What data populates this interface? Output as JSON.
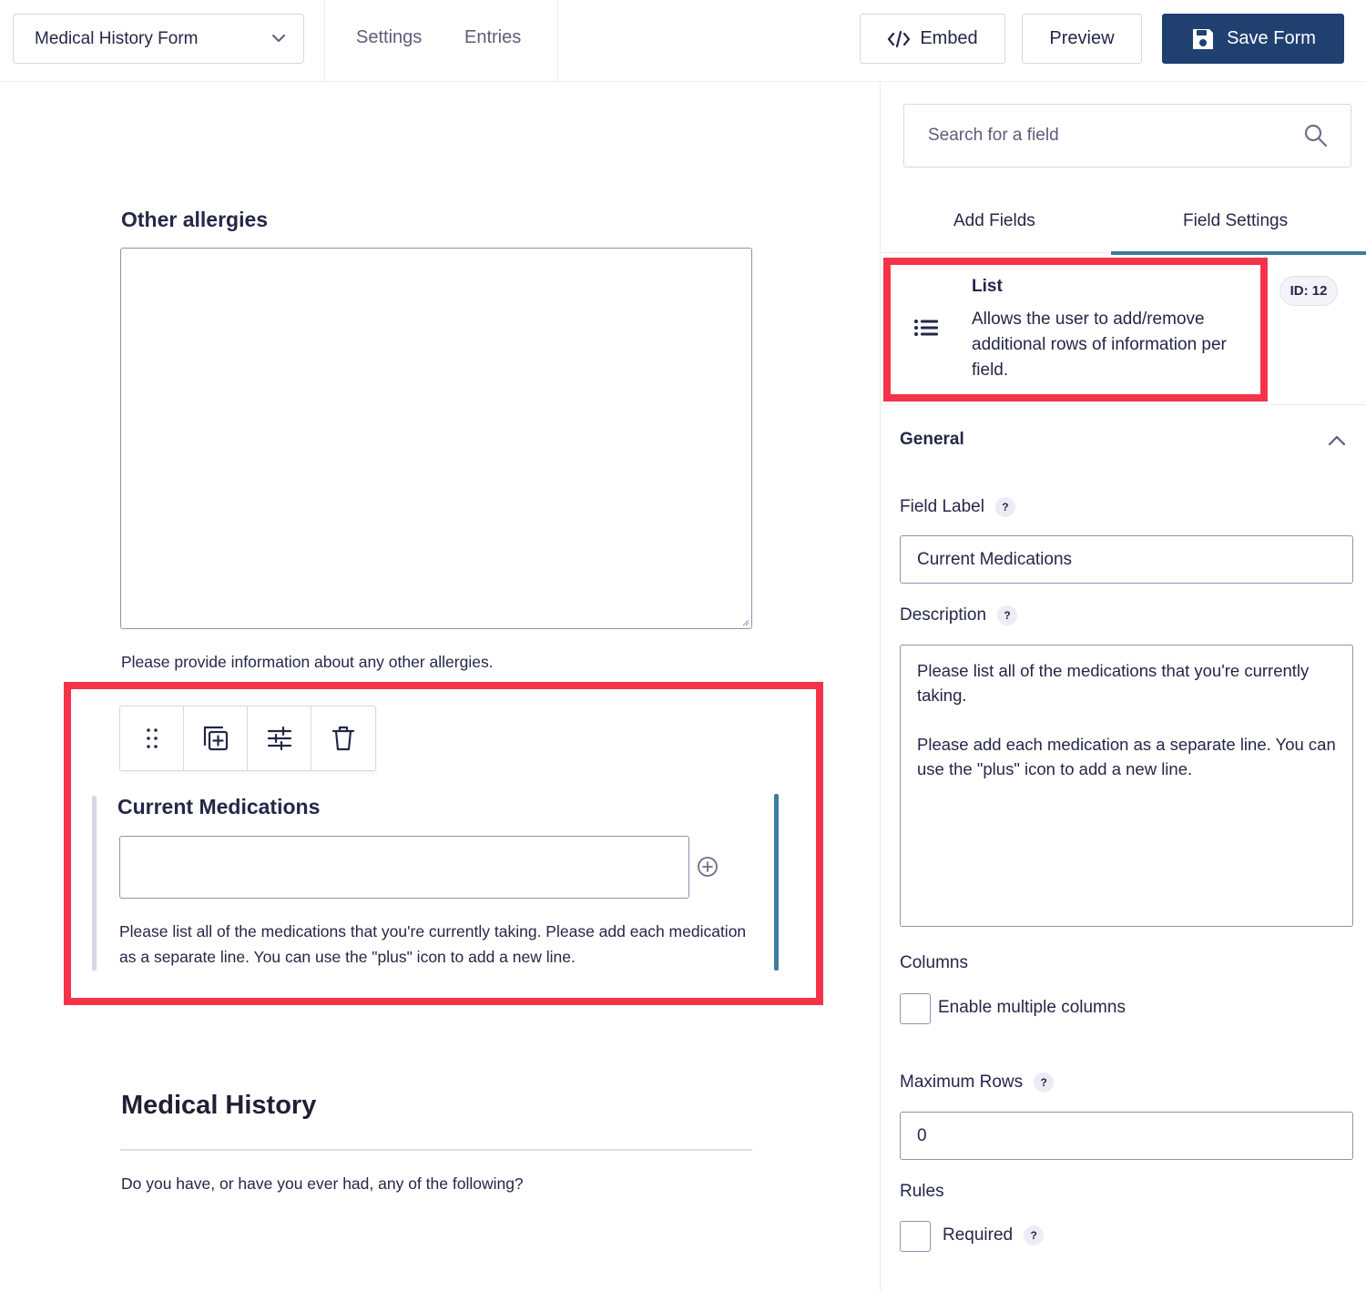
{
  "topbar": {
    "form_name": "Medical History Form",
    "nav": {
      "settings": "Settings",
      "entries": "Entries"
    },
    "buttons": {
      "embed": "Embed",
      "preview": "Preview",
      "save": "Save Form"
    },
    "colors": {
      "primary": "#204170"
    }
  },
  "canvas": {
    "other_allergies": {
      "label": "Other allergies",
      "description": "Please provide information about any other allergies."
    },
    "field_toolbar": {
      "icons": [
        "drag-handle-icon",
        "duplicate-icon",
        "settings-sliders-icon",
        "trash-icon"
      ]
    },
    "current_medications": {
      "label": "Current Medications",
      "input_value": "",
      "description": "Please list all of the medications that you're currently taking. Please add each medication as a separate line. You can use the \"plus\" icon to add a new line."
    },
    "medical_history": {
      "title": "Medical History",
      "question": "Do you have, or have you ever had, any of the following?"
    },
    "highlight_color": "#f4334a"
  },
  "sidebar": {
    "search": {
      "placeholder": "Search for a field"
    },
    "tabs": {
      "add_fields": "Add Fields",
      "field_settings": "Field Settings",
      "active": "Field Settings"
    },
    "field_info": {
      "title": "List",
      "description": "Allows the user to add/remove additional rows of information per field.",
      "id_badge": "ID: 12"
    },
    "general": {
      "title": "General",
      "field_label": {
        "label": "Field Label",
        "value": "Current Medications"
      },
      "description": {
        "label": "Description",
        "value": "Please list all of the medications that you're currently taking.\n\nPlease add each medication as a separate line. You can use the \"plus\" icon to add a new line."
      },
      "columns": {
        "label": "Columns",
        "checkbox_label": "Enable multiple columns",
        "checked": false
      },
      "maximum_rows": {
        "label": "Maximum Rows",
        "value": "0"
      },
      "rules": {
        "label": "Rules",
        "checkbox_label": "Required",
        "checked": false
      }
    },
    "help_marker": "?"
  }
}
